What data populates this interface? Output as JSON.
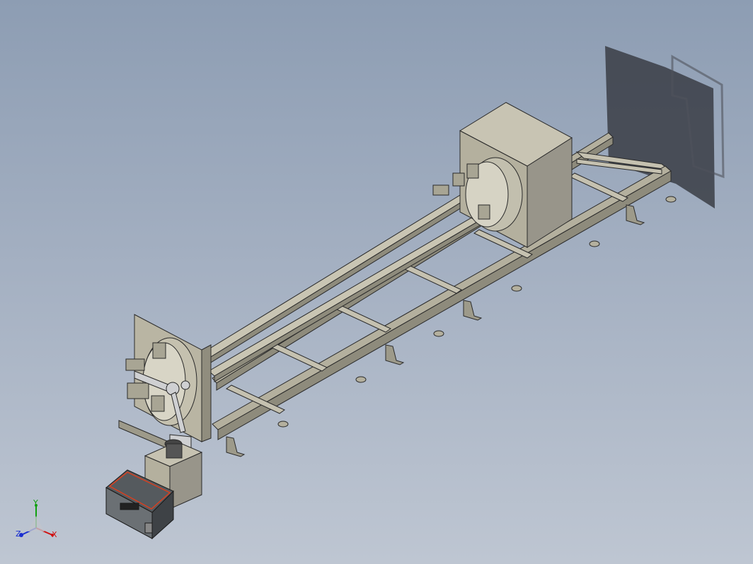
{
  "viewport": {
    "background_top": "#8d9db3",
    "background_bottom": "#bec6d2",
    "model_color": "#b4b09e",
    "edge_color": "#2a2a2a"
  },
  "triad": {
    "x_label": "X",
    "y_label": "Y",
    "z_label": "Z",
    "x_color": "#d01010",
    "y_color": "#10a010",
    "z_color": "#1a2fd0"
  }
}
